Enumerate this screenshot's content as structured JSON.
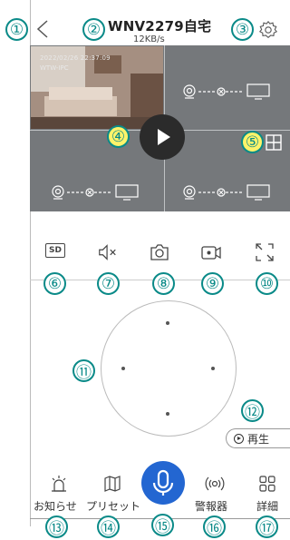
{
  "header": {
    "title": "WNV2279自宅",
    "subtitle": "12KB/s",
    "back_icon": "chevron-left-icon",
    "settings_icon": "gear-icon"
  },
  "video": {
    "timestamp": "2022/02/26  22:37:09",
    "channel_name": "WTW-IPC",
    "empty_channel_icon": "camera-disconnected-monitor-icon",
    "layout_icon": "four-grid-icon"
  },
  "toolbar": {
    "quality_label": "SD",
    "items": [
      "sd-quality-icon",
      "mute-icon",
      "snapshot-icon",
      "record-icon",
      "fullscreen-icon"
    ]
  },
  "replay": {
    "label": "再生"
  },
  "bottom_nav": {
    "notifications": "お知らせ",
    "presets": "プリセット",
    "alarm": "警報器",
    "details": "詳細"
  },
  "callouts": [
    "①",
    "②",
    "③",
    "④",
    "⑤",
    "⑥",
    "⑦",
    "⑧",
    "⑨",
    "⑩",
    "⑪",
    "⑫",
    "⑬",
    "⑭",
    "⑮",
    "⑯",
    "⑰"
  ],
  "colors": {
    "accent": "#2366d1",
    "callout": "#0a8a88",
    "highlight": "#fff36a",
    "video_bg": "#75787b"
  }
}
